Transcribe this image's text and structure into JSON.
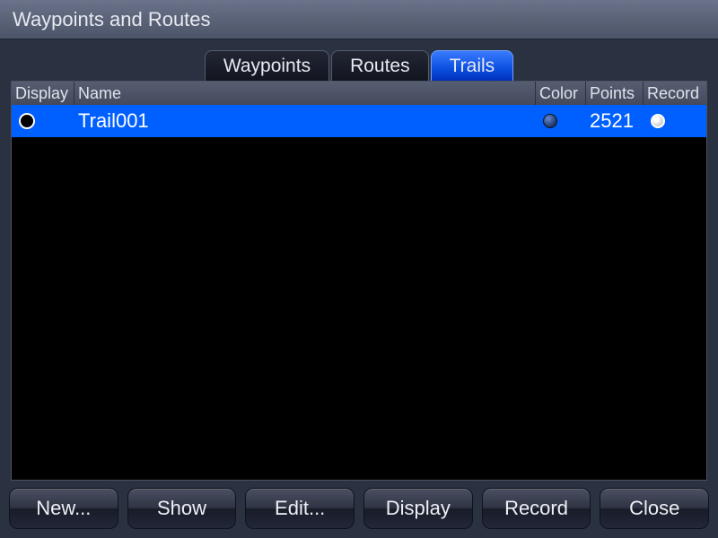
{
  "window": {
    "title": "Waypoints and Routes"
  },
  "tabs": [
    {
      "label": "Waypoints",
      "active": false
    },
    {
      "label": "Routes",
      "active": false
    },
    {
      "label": "Trails",
      "active": true
    }
  ],
  "columns": {
    "display": "Display",
    "name": "Name",
    "color": "Color",
    "points": "Points",
    "record": "Record"
  },
  "rows": [
    {
      "display": false,
      "name": "Trail001",
      "color": "#2b4680",
      "points": "2521",
      "record": true,
      "selected": true
    }
  ],
  "buttons": {
    "new": "New...",
    "show": "Show",
    "edit": "Edit...",
    "display": "Display",
    "record": "Record",
    "close": "Close"
  }
}
